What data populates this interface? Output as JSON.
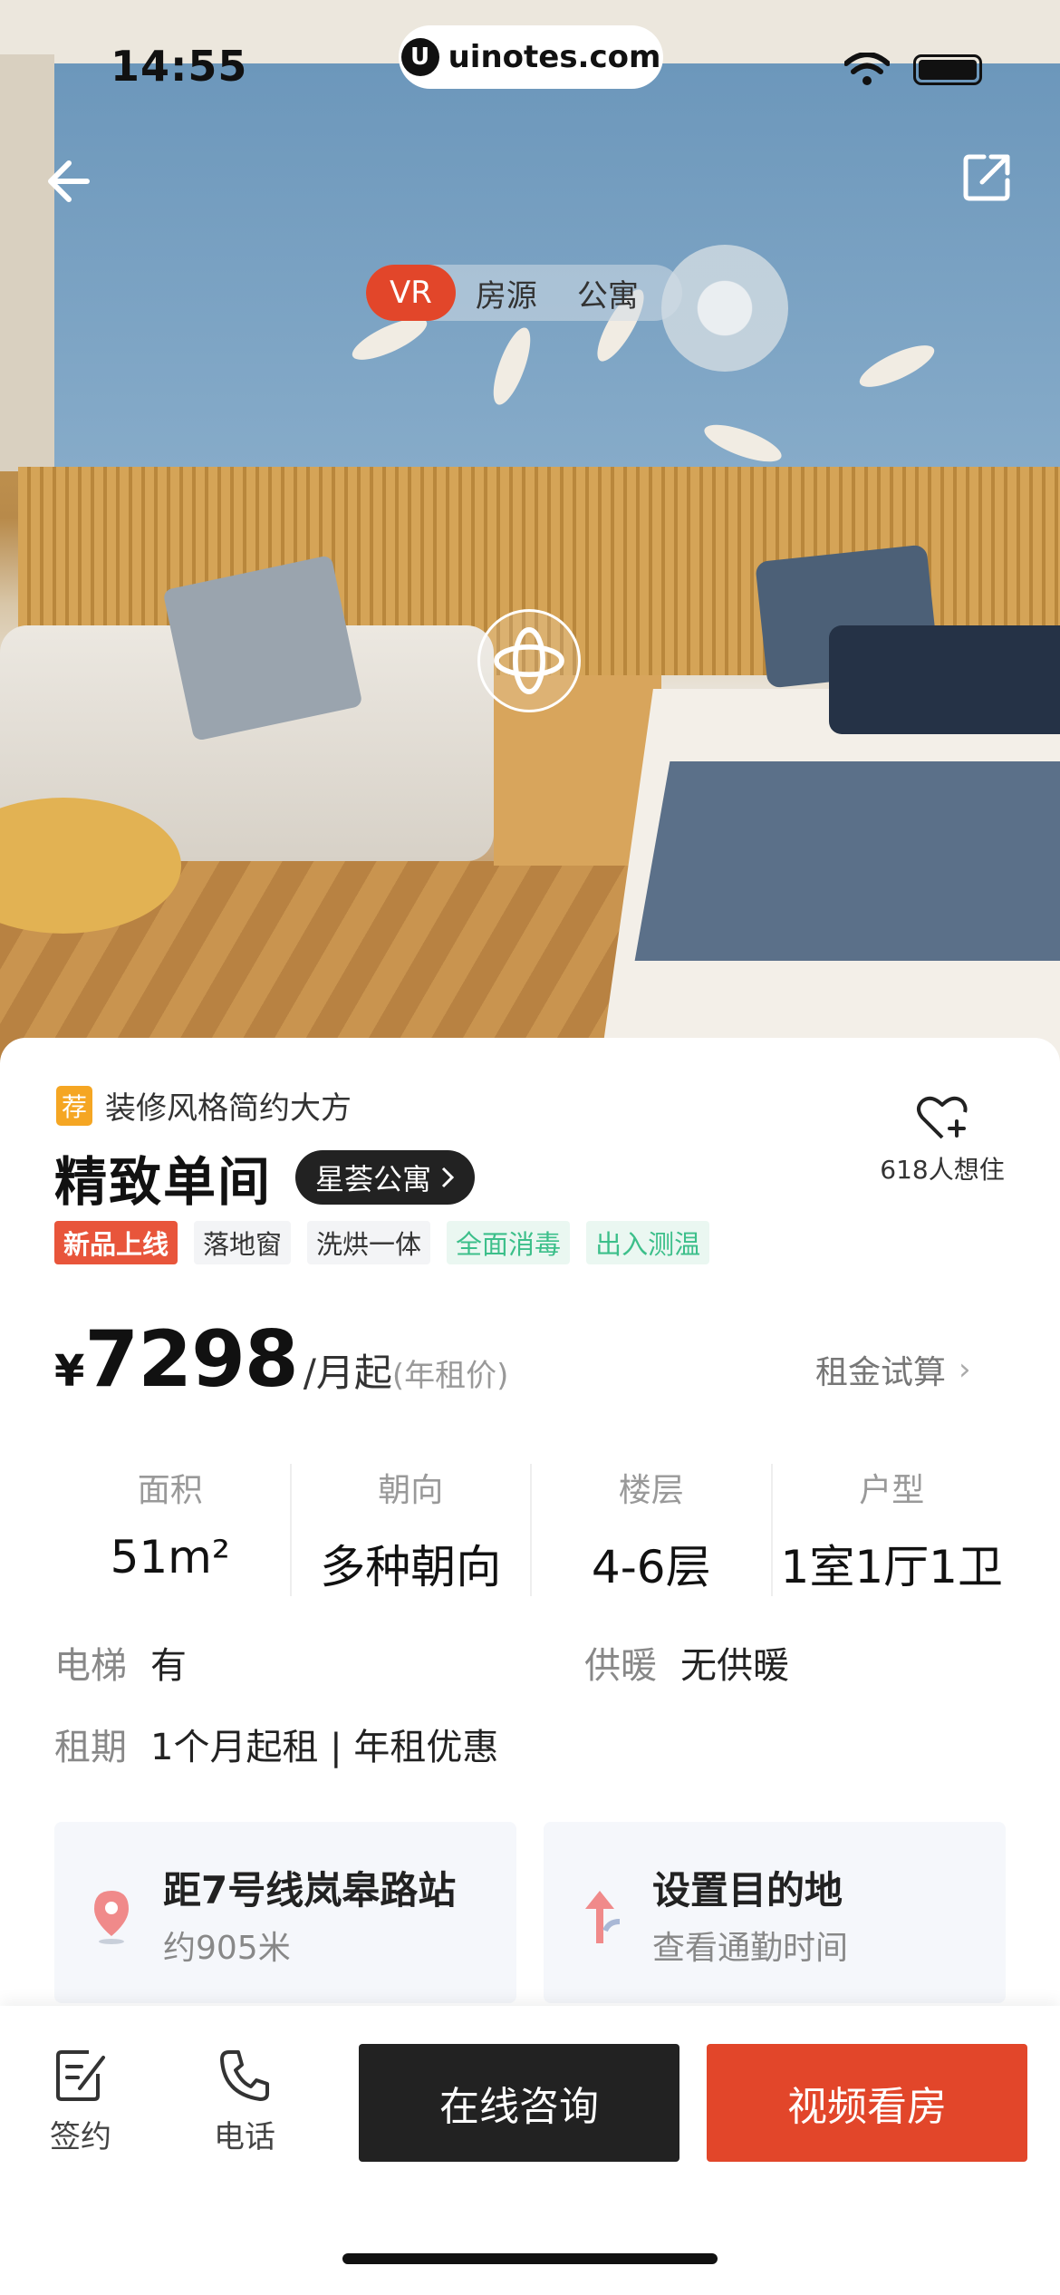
{
  "status_bar": {
    "time": "14:55",
    "watermark": "uinotes.com"
  },
  "hero": {
    "media_tabs": [
      {
        "label": "VR",
        "active": true
      },
      {
        "label": "房源",
        "active": false
      },
      {
        "label": "公寓",
        "active": false
      }
    ]
  },
  "listing": {
    "recommend_badge": "荐",
    "recommend_text": "装修风格简约大方",
    "title": "精致单间",
    "brand": "星荟公寓",
    "favorite_count": "618人想住",
    "tags": [
      {
        "label": "新品上线",
        "style": "new"
      },
      {
        "label": "落地窗",
        "style": "plain"
      },
      {
        "label": "洗烘一体",
        "style": "plain"
      },
      {
        "label": "全面消毒",
        "style": "green"
      },
      {
        "label": "出入测温",
        "style": "green"
      }
    ],
    "price": {
      "currency": "¥",
      "amount": "7298",
      "unit": "/月起",
      "note": "(年租价)"
    },
    "rent_calc": "租金试算",
    "stats": [
      {
        "label": "面积",
        "value": "51m²"
      },
      {
        "label": "朝向",
        "value": "多种朝向"
      },
      {
        "label": "楼层",
        "value": "4-6层"
      },
      {
        "label": "户型",
        "value": "1室1厅1卫"
      }
    ],
    "details": {
      "elevator": {
        "key": "电梯",
        "value": "有"
      },
      "heating": {
        "key": "供暖",
        "value": "无供暖"
      },
      "lease": {
        "key": "租期",
        "value": "1个月起租 | 年租优惠"
      }
    },
    "location_card": {
      "title": "距7号线岚皋路站",
      "subtitle": "约905米"
    },
    "commute_card": {
      "title": "设置目的地",
      "subtitle": "查看通勤时间"
    }
  },
  "bottom_bar": {
    "sign_label": "签约",
    "phone_label": "电话",
    "consult_label": "在线咨询",
    "video_label": "视频看房"
  },
  "colors": {
    "accent": "#e2462a",
    "badge": "#f5a623",
    "green_tag": "#3cbf8a",
    "dark": "#222222"
  }
}
